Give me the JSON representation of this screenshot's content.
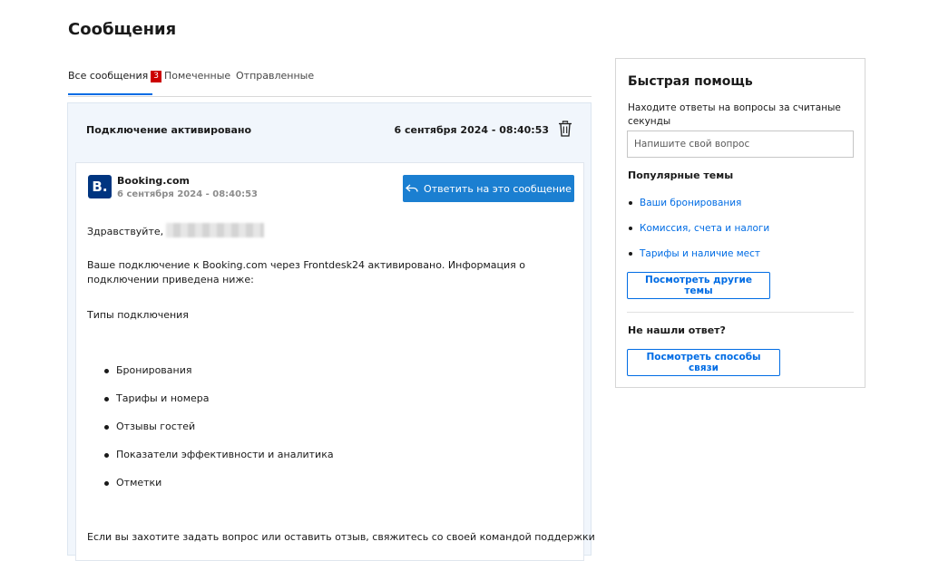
{
  "page": {
    "title": "Сообщения"
  },
  "tabs": [
    {
      "label": "Все сообщения",
      "badge": "3",
      "active": true
    },
    {
      "label": "Помеченные"
    },
    {
      "label": "Отправленные"
    }
  ],
  "thread": {
    "subject": "Подключение активировано",
    "date": "6 сентября 2024 - 08:40:53",
    "delete_icon": "trash-icon"
  },
  "message": {
    "sender": "Booking.com",
    "logo_letter": "B.",
    "date": "6 сентября 2024 - 08:40:53",
    "reply_label": "Ответить на это сообщение",
    "reply_icon": "reply-arrow-icon",
    "greeting": "Здравствуйте,",
    "intro": "Ваше подключение к Booking.com через Frontdesk24 активировано. Информация о подключении приведена ниже:",
    "types_heading": "Типы подключения",
    "types": [
      "Бронирования",
      "Тарифы и номера",
      "Отзывы гостей",
      "Показатели эффективности и аналитика",
      "Отметки"
    ],
    "closing": "Если вы захотите задать вопрос или оставить отзыв, свяжитесь со своей командой поддержки"
  },
  "help": {
    "title": "Быстрая помощь",
    "subtitle": "Находите ответы на вопросы за считаные секунды",
    "search_placeholder": "Напишите свой вопрос",
    "popular_heading": "Популярные темы",
    "topics": [
      "Ваши бронирования",
      "Комиссия, счета и налоги",
      "Тарифы и наличие мест"
    ],
    "more_topics_label": "Посмотреть другие темы",
    "no_answer_heading": "Не нашли ответ?",
    "contact_label": "Посмотреть способы связи"
  },
  "colors": {
    "accent": "#006ce4",
    "reply_button": "#1b7fd1",
    "badge": "#cc0000",
    "logo": "#003580"
  }
}
